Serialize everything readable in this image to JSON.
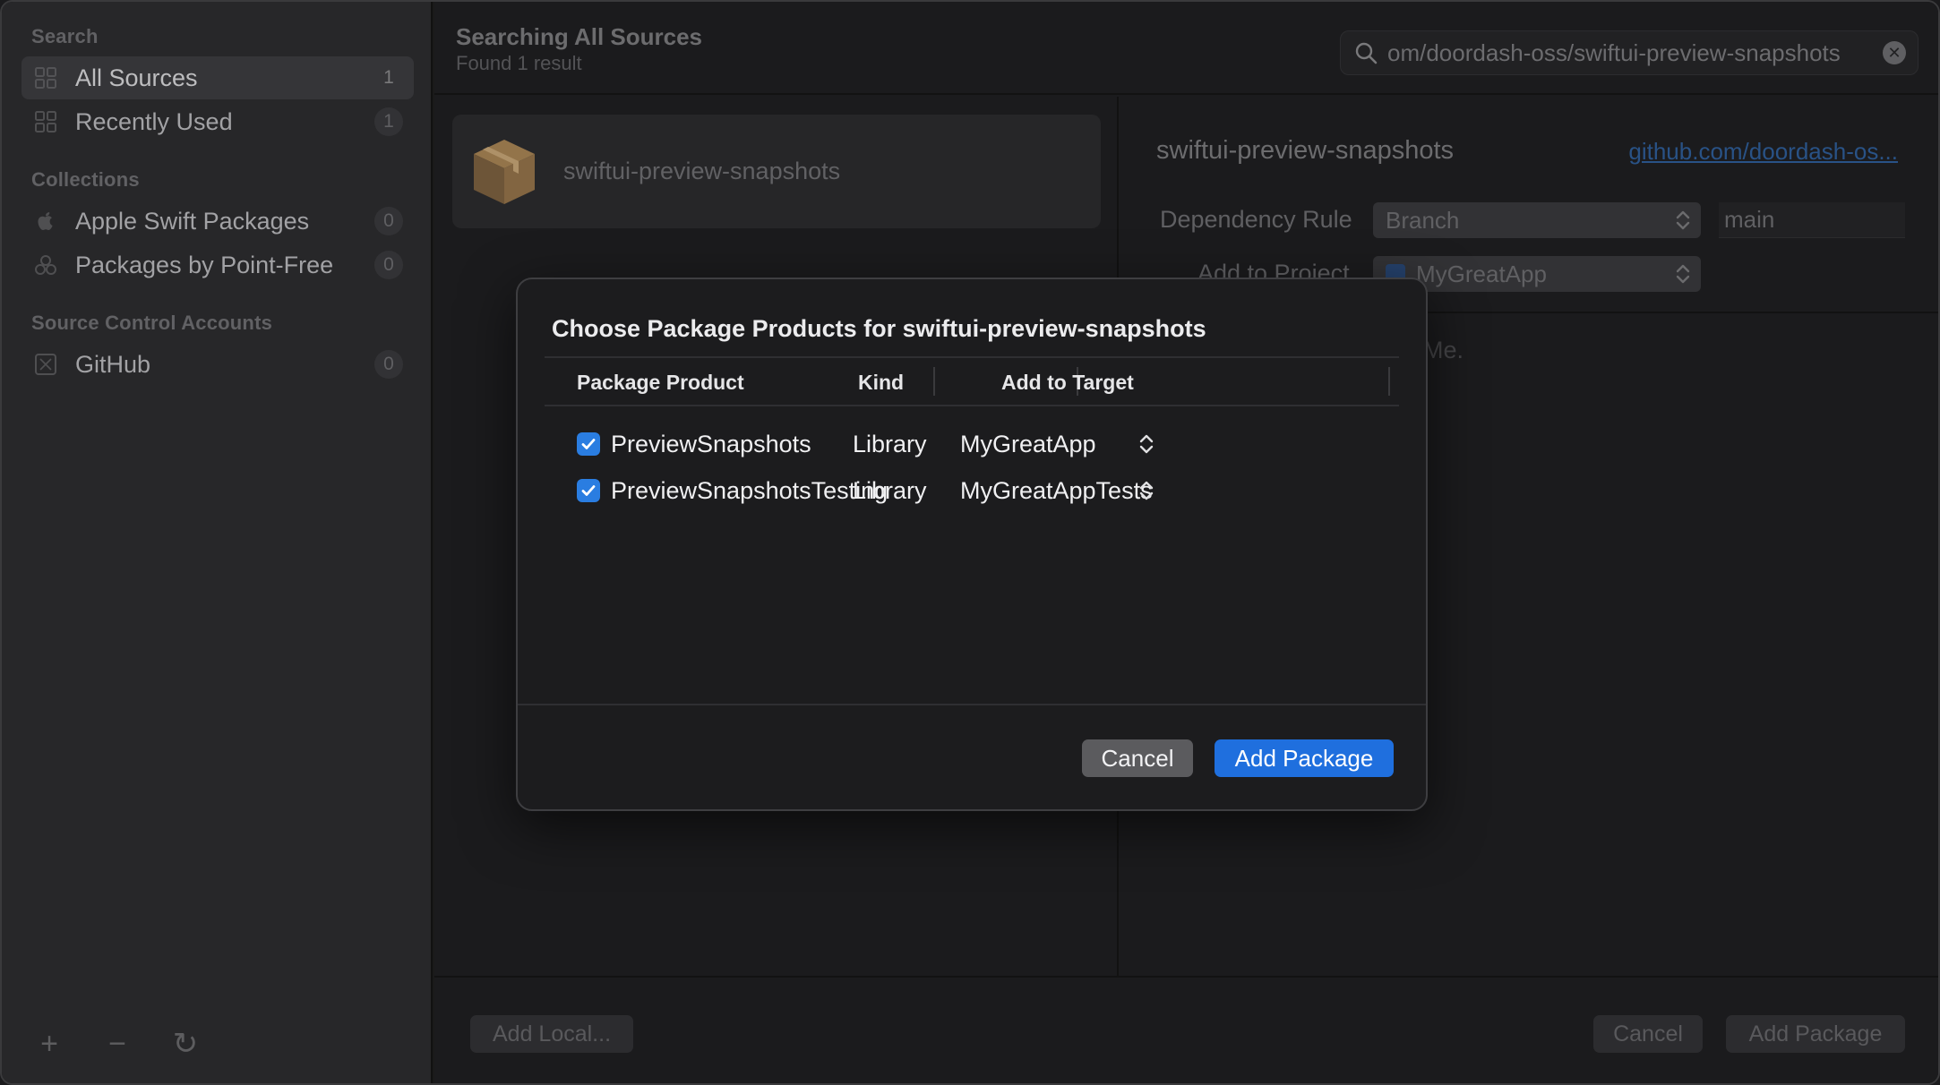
{
  "sidebar": {
    "search_section": "Search",
    "items": [
      {
        "label": "All Sources",
        "count": "1",
        "icon": "grid-icon"
      },
      {
        "label": "Recently Used",
        "count": "1",
        "icon": "grid-icon"
      }
    ],
    "collections_section": "Collections",
    "collections": [
      {
        "label": "Apple Swift Packages",
        "count": "0",
        "icon": "apple-icon"
      },
      {
        "label": "Packages by Point-Free",
        "count": "0",
        "icon": "collection-icon"
      }
    ],
    "accounts_section": "Source Control Accounts",
    "accounts": [
      {
        "label": "GitHub",
        "count": "0",
        "icon": "github-icon"
      }
    ],
    "footer": {
      "add": "+",
      "remove": "−",
      "refresh": "↻"
    }
  },
  "header": {
    "title": "Searching All Sources",
    "subtitle": "Found 1 result",
    "search_value": "om/doordash-oss/swiftui-preview-snapshots"
  },
  "results": [
    {
      "name": "swiftui-preview-snapshots"
    }
  ],
  "detail": {
    "title": "swiftui-preview-snapshots",
    "link": "github.com/doordash-os...",
    "dependency_rule_label": "Dependency Rule",
    "dependency_rule_value": "Branch",
    "branch_value": "main",
    "add_to_project_label": "Add to Project",
    "project_value": "MyGreatApp",
    "faded_text": "Me."
  },
  "bottom": {
    "add_local": "Add Local...",
    "cancel": "Cancel",
    "add_package": "Add Package"
  },
  "modal": {
    "title": "Choose Package Products for swiftui-preview-snapshots",
    "columns": {
      "product": "Package Product",
      "kind": "Kind",
      "target": "Add to Target"
    },
    "rows": [
      {
        "product": "PreviewSnapshots",
        "kind": "Library",
        "target": "MyGreatApp",
        "checked": true
      },
      {
        "product": "PreviewSnapshotsTesting",
        "kind": "Library",
        "target": "MyGreatAppTests",
        "checked": true
      }
    ],
    "cancel": "Cancel",
    "add_package": "Add Package"
  },
  "colors": {
    "accent": "#1f6fde",
    "checkbox": "#2a7de1",
    "link": "#2f5e99"
  }
}
